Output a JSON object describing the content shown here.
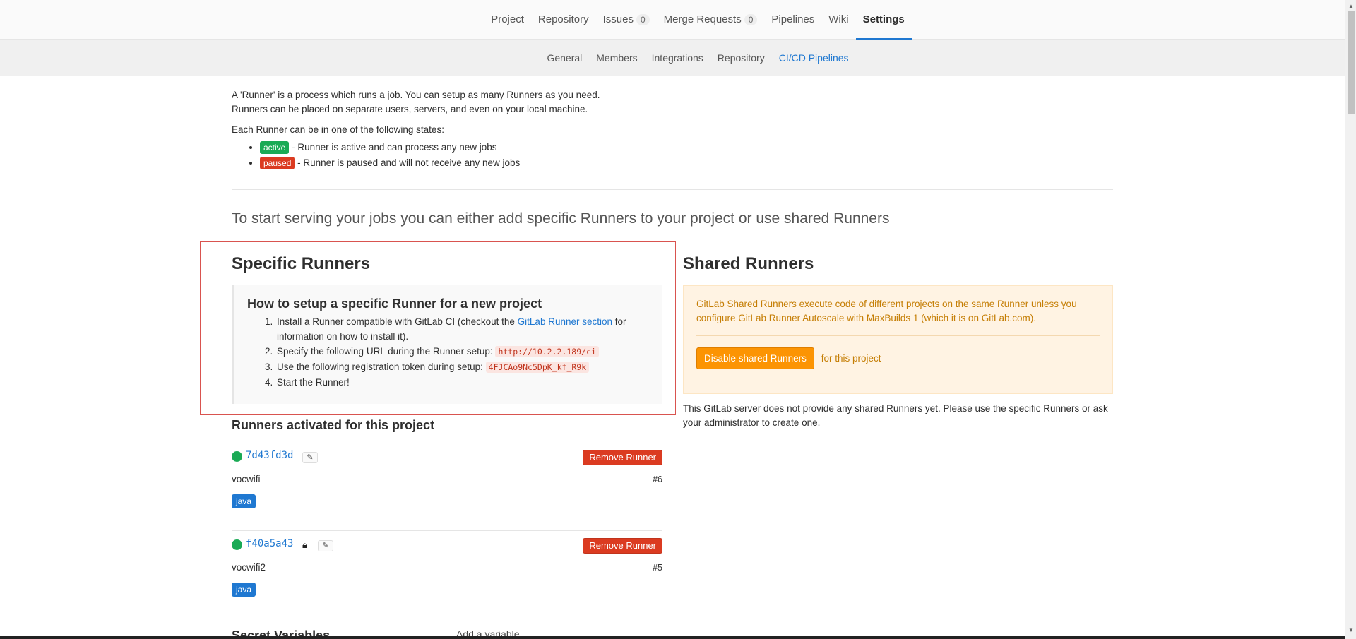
{
  "nav": {
    "tabs": [
      {
        "label": "Project"
      },
      {
        "label": "Repository"
      },
      {
        "label": "Issues",
        "count": "0"
      },
      {
        "label": "Merge Requests",
        "count": "0"
      },
      {
        "label": "Pipelines"
      },
      {
        "label": "Wiki"
      },
      {
        "label": "Settings",
        "active": true
      }
    ]
  },
  "subnav": {
    "tabs": [
      "General",
      "Members",
      "Integrations",
      "Repository",
      "CI/CD Pipelines"
    ],
    "active": "CI/CD Pipelines"
  },
  "intro": {
    "line1": "A 'Runner' is a process which runs a job. You can setup as many Runners as you need.",
    "line2": "Runners can be placed on separate users, servers, and even on your local machine.",
    "states_intro": "Each Runner can be in one of the following states:",
    "active_badge": "active",
    "active_text": " - Runner is active and can process any new jobs",
    "paused_badge": "paused",
    "paused_text": " - Runner is paused and will not receive any new jobs"
  },
  "lead": "To start serving your jobs you can either add specific Runners to your project or use shared Runners",
  "specific": {
    "title": "Specific Runners",
    "setup_title": "How to setup a specific Runner for a new project",
    "step1_a": "Install a Runner compatible with GitLab CI (checkout the ",
    "step1_link": "GitLab Runner section",
    "step1_b": " for information on how to install it).",
    "step2": "Specify the following URL during the Runner setup: ",
    "url": "http://10.2.2.189/ci",
    "step3": "Use the following registration token during setup: ",
    "token": "4FJCAo9Nc5DpK_kf_R9k",
    "step4": "Start the Runner!"
  },
  "activated": {
    "title": "Runners activated for this project",
    "remove_label": "Remove Runner",
    "runners": [
      {
        "id": "7d43fd3d",
        "desc": "vocwifi",
        "num": "#6",
        "tag": "java",
        "locked": false
      },
      {
        "id": "f40a5a43",
        "desc": "vocwifi2",
        "num": "#5",
        "tag": "java",
        "locked": true
      }
    ]
  },
  "shared": {
    "title": "Shared Runners",
    "warning": "GitLab Shared Runners execute code of different projects on the same Runner unless you configure GitLab Runner Autoscale with MaxBuilds 1 (which it is on GitLab.com).",
    "disable_button": "Disable shared Runners",
    "for_project": "for this project",
    "note": "This GitLab server does not provide any shared Runners yet. Please use the specific Runners or ask your administrator to create one."
  },
  "peek": {
    "section": "Secret Variables",
    "add": "Add a variable"
  },
  "colors": {
    "accent": "#1f78d1",
    "active": "#1aaa55",
    "danger": "#db3b21",
    "warning": "#fc9403"
  }
}
